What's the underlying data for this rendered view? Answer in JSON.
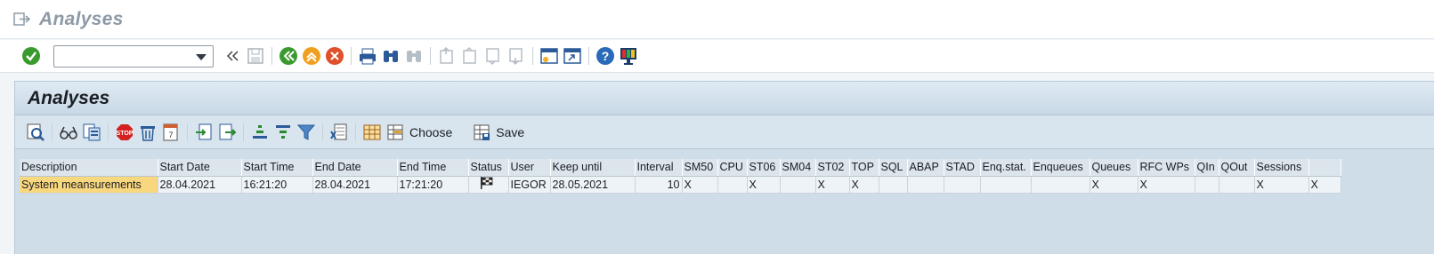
{
  "window": {
    "title": "Analyses"
  },
  "system_toolbar": {
    "command_field": {
      "value": "",
      "placeholder": ""
    },
    "icons": [
      "enter-icon",
      "collapse-icon",
      "save-icon",
      "back-icon",
      "exit-icon",
      "cancel-icon",
      "print-icon",
      "find-icon",
      "find-next-icon",
      "first-page-icon",
      "previous-page-icon",
      "next-page-icon",
      "last-page-icon",
      "new-session-icon",
      "shortcut-icon",
      "help-icon",
      "layout-icon"
    ]
  },
  "panel": {
    "title": "Analyses",
    "toolbar": {
      "choose_label": "Choose",
      "save_label": "Save"
    }
  },
  "table": {
    "columns": [
      "Description",
      "Start Date",
      "Start Time",
      "End Date",
      "End Time",
      "Status",
      "User",
      "Keep until",
      "Interval",
      "SM50",
      "CPU",
      "ST06",
      "SM04",
      "ST02",
      "TOP",
      "SQL",
      "ABAP",
      "STAD",
      "Enq.stat.",
      "Enqueues",
      "Queues",
      "RFC WPs",
      "QIn",
      "QOut",
      "Sessions",
      ""
    ],
    "rows": [
      [
        "System meansurements",
        "28.04.2021",
        "16:21:20",
        "28.04.2021",
        "17:21:20",
        "",
        "IEGOR",
        "28.05.2021",
        "10",
        "X",
        "",
        "X",
        "",
        "X",
        "X",
        "",
        "",
        "",
        "",
        "",
        "X",
        "X",
        "",
        "",
        "X",
        "X"
      ]
    ]
  },
  "colors": {
    "highlight": "#f9d77e",
    "panel_bg": "#cfdde8",
    "green_ok": "#3a9a2e",
    "stop_red": "#d42020"
  }
}
